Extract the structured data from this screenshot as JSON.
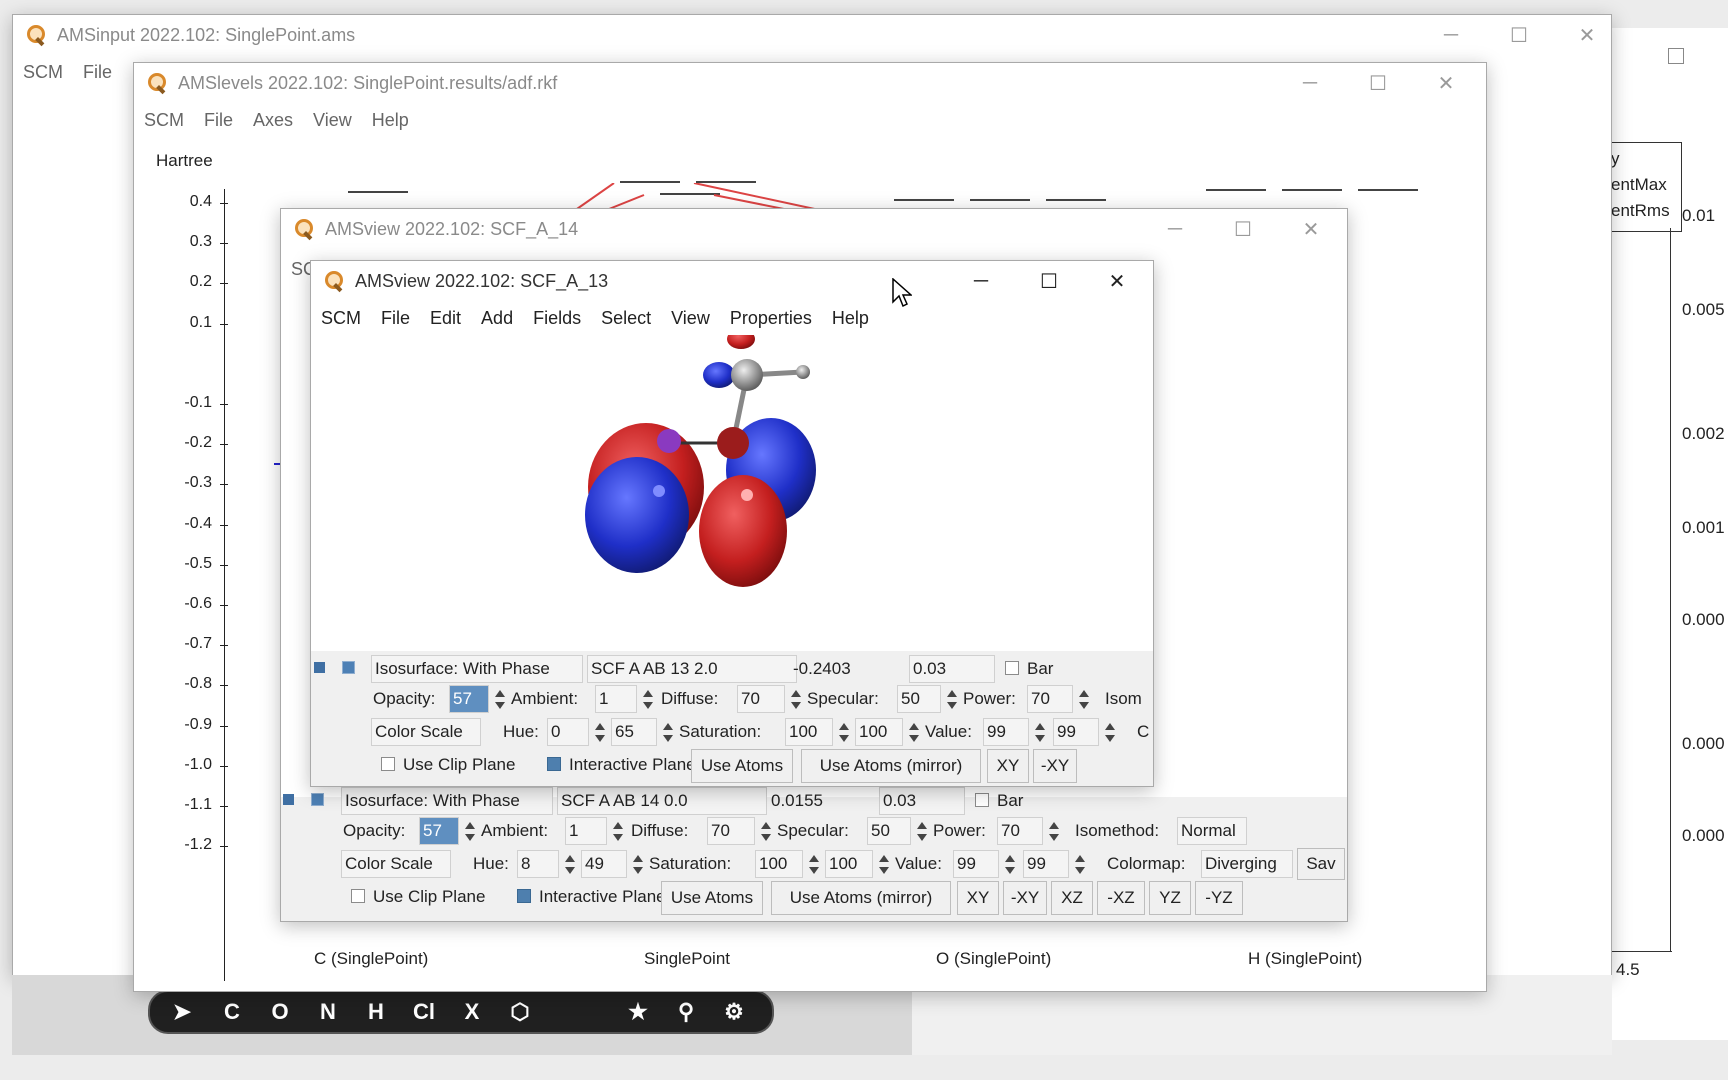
{
  "amsinput": {
    "title": "AMSinput 2022.102: SinglePoint.ams",
    "menu": [
      "SCM",
      "File"
    ]
  },
  "amslevels": {
    "title": "AMSlevels 2022.102: SinglePoint.results/adf.rkf",
    "menu": [
      "SCM",
      "File",
      "Axes",
      "View",
      "Help"
    ],
    "yaxis_label": "Hartree",
    "yticks": [
      "0.4",
      "0.3",
      "0.2",
      "0.1",
      "-0.1",
      "-0.2",
      "-0.3",
      "-0.4",
      "-0.5",
      "-0.6",
      "-0.7",
      "-0.8",
      "-0.9",
      "-1.0",
      "-1.1",
      "-1.2"
    ],
    "xlabels": [
      "C (SinglePoint)",
      "SinglePoint",
      "O (SinglePoint)",
      "H (SinglePoint)"
    ]
  },
  "amsview14": {
    "title": "AMSview 2022.102: SCF_A_14",
    "menu_fragment": "SC",
    "isosurface": {
      "label": "Isosurface: With Phase",
      "field": "SCF A AB 14 0.0",
      "value_readout": "0.0155",
      "isovalue": "0.03",
      "bar_label": "Bar",
      "opacity_label": "Opacity:",
      "opacity": "57",
      "ambient_label": "Ambient:",
      "ambient": "1",
      "diffuse_label": "Diffuse:",
      "diffuse": "70",
      "specular_label": "Specular:",
      "specular": "50",
      "power_label": "Power:",
      "power": "70",
      "isomethod_label": "Isomethod:",
      "isomethod": "Normal",
      "colorscale": "Color Scale",
      "hue_label": "Hue:",
      "hue1": "8",
      "hue2": "49",
      "sat_label": "Saturation:",
      "sat1": "100",
      "sat2": "100",
      "val_label": "Value:",
      "val1": "99",
      "val2": "99",
      "colormap_label": "Colormap:",
      "colormap": "Diverging",
      "save_fragment": "Sav",
      "clip_label": "Use Clip Plane",
      "interactive_label": "Interactive Plane",
      "use_atoms": "Use Atoms",
      "use_atoms_mirror": "Use Atoms (mirror)",
      "planes": [
        "XY",
        "-XY",
        "XZ",
        "-XZ",
        "YZ",
        "-YZ"
      ]
    }
  },
  "amsview13": {
    "title": "AMSview 2022.102: SCF_A_13",
    "menu": [
      "SCM",
      "File",
      "Edit",
      "Add",
      "Fields",
      "Select",
      "View",
      "Properties",
      "Help"
    ],
    "isosurface": {
      "label": "Isosurface: With Phase",
      "field": "SCF A AB 13 2.0",
      "value_readout": "-0.2403",
      "isovalue": "0.03",
      "bar_label": "Bar",
      "opacity_label": "Opacity:",
      "opacity": "57",
      "ambient_label": "Ambient:",
      "ambient": "1",
      "diffuse_label": "Diffuse:",
      "diffuse": "70",
      "specular_label": "Specular:",
      "specular": "50",
      "power_label": "Power:",
      "power": "70",
      "isom_fragment": "Isom",
      "colorscale": "Color Scale",
      "hue_label": "Hue:",
      "hue1": "0",
      "hue2": "65",
      "sat_label": "Saturation:",
      "sat1": "100",
      "sat2": "100",
      "val_label": "Value:",
      "val1": "99",
      "val2": "99",
      "c_fragment": "C",
      "clip_label": "Use Clip Plane",
      "interactive_label": "Interactive Plane",
      "use_atoms": "Use Atoms",
      "use_atoms_mirror": "Use Atoms (mirror)",
      "planes": [
        "XY",
        "-XY"
      ]
    }
  },
  "right_panel": {
    "labels": [
      "y",
      "entMax",
      "entRms"
    ],
    "axis_values": [
      "0.01",
      "0.005",
      "0.002",
      "0.001",
      "0.000",
      "0.000",
      "0.000"
    ],
    "x_value": "4.5"
  },
  "toolbar": {
    "items": [
      "C",
      "O",
      "N",
      "H",
      "Cl",
      "X"
    ]
  },
  "colors": {
    "accent": "#4e7fae",
    "orbital_red": "#d42a2a",
    "orbital_blue": "#2a3ed4"
  }
}
